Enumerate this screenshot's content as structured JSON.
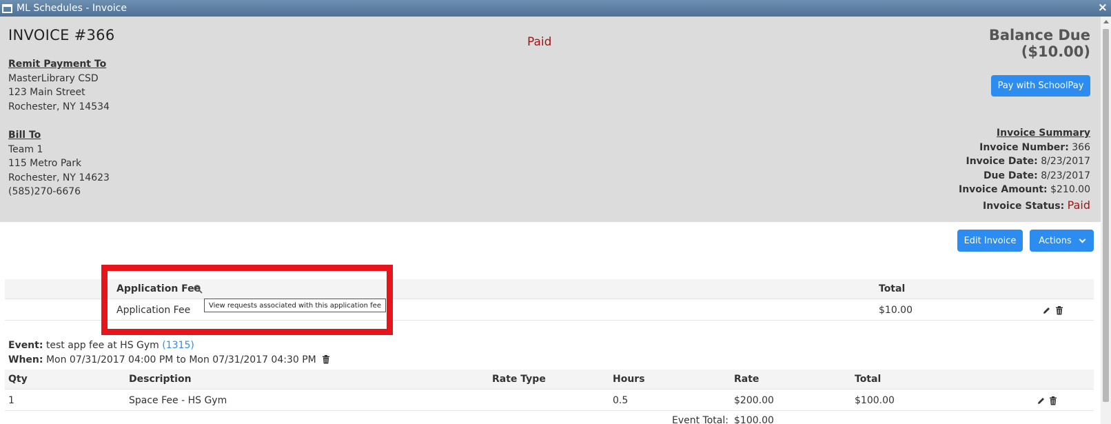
{
  "window": {
    "title": "ML Schedules - Invoice",
    "close": "×"
  },
  "invoice": {
    "title": "INVOICE #366",
    "status_center": "Paid",
    "remit": {
      "heading": "Remit Payment To",
      "lines": [
        "MasterLibrary CSD",
        "123 Main Street",
        "Rochester, NY 14534"
      ]
    },
    "bill_to": {
      "heading": "Bill To",
      "lines": [
        "Team 1",
        "115 Metro Park",
        "Rochester, NY 14623",
        "(585)270-6676"
      ]
    },
    "balance": {
      "label": "Balance Due",
      "amount": "($10.00)"
    },
    "pay_button": "Pay with SchoolPay",
    "summary": {
      "heading": "Invoice Summary",
      "number_label": "Invoice Number:",
      "number": "366",
      "date_label": "Invoice Date:",
      "date": "8/23/2017",
      "due_label": "Due Date:",
      "due": "8/23/2017",
      "amount_label": "Invoice Amount:",
      "amount": "$210.00",
      "status_label": "Invoice Status:",
      "status": "Paid"
    }
  },
  "toolbar": {
    "edit": "Edit Invoice",
    "actions": "Actions"
  },
  "app_fee": {
    "header": "Application Fee",
    "total_header": "Total",
    "row_description": "Application Fee",
    "row_total": "$10.00",
    "tooltip": "View requests associated with this application fee"
  },
  "event": {
    "event_label": "Event:",
    "event_text": "test app fee at HS Gym",
    "event_link": "(1315)",
    "when_label": "When:",
    "when_text": "Mon 07/31/2017 04:00 PM to Mon 07/31/2017 04:30 PM",
    "columns": [
      "Qty",
      "Description",
      "Rate Type",
      "Hours",
      "Rate",
      "Total"
    ],
    "rows": [
      {
        "qty": "1",
        "description": "Space Fee - HS Gym",
        "rate_type": "",
        "hours": "0.5",
        "rate": "$200.00",
        "total": "$100.00"
      }
    ],
    "total_label": "Event Total:",
    "total_value": "$100.00"
  },
  "colors": {
    "primary": "#2d8cf0",
    "paid": "#a31515",
    "highlight": "#e8141c",
    "panel": "#dcdcdc"
  },
  "icons": [
    "window-icon",
    "close-icon",
    "search-icon",
    "pencil-icon",
    "trash-icon",
    "chevron-down-icon"
  ]
}
